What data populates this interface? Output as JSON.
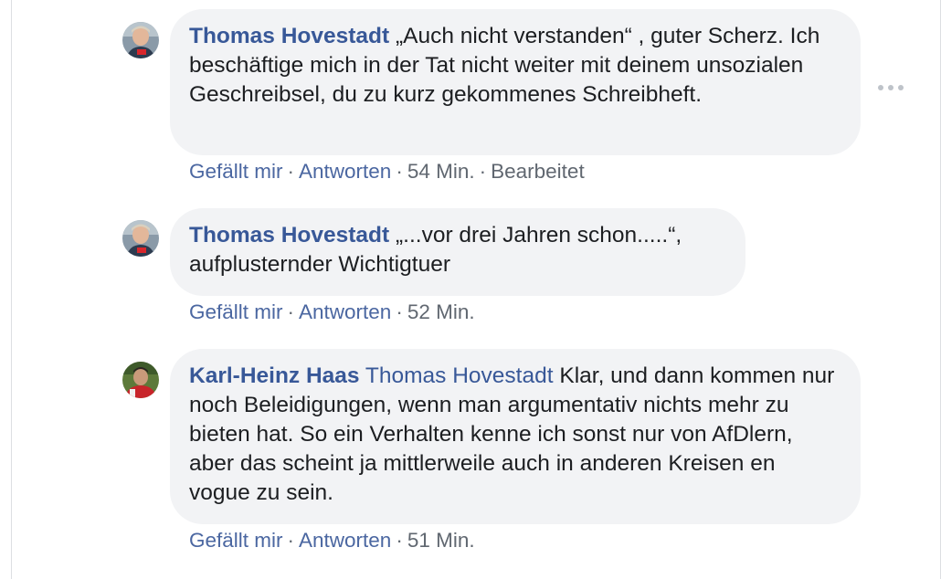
{
  "comments": [
    {
      "author": "Thomas Hovestadt",
      "mention": "",
      "text": " „Auch nicht verstanden“ , guter Scherz. Ich beschäftige mich in der Tat nicht weiter mit deinem unsozialen Geschreibsel, du zu kurz gekommenes Schreibheft.",
      "like_label": "Gefällt mir",
      "reply_label": "Antworten",
      "time": "54 Min.",
      "edited": "Bearbeitet",
      "avatar_icon": "profile-photo"
    },
    {
      "author": "Thomas Hovestadt",
      "mention": "",
      "text": " „...vor drei Jahren schon.....“, aufplusternder Wichtigtuer",
      "like_label": "Gefällt mir",
      "reply_label": "Antworten",
      "time": "52 Min.",
      "avatar_icon": "profile-photo"
    },
    {
      "author": "Karl-Heinz Haas",
      "mention": "Thomas Hovestadt",
      "text": " Klar, und dann kommen nur noch Beleidigungen, wenn man argumentativ nichts mehr zu bieten hat. So ein Verhalten kenne ich sonst nur von AfDlern, aber das scheint ja mittlerweile auch in anderen Kreisen en vogue zu sein.",
      "like_label": "Gefällt mir",
      "reply_label": "Antworten",
      "time": "51 Min.",
      "avatar_icon": "profile-photo"
    }
  ],
  "more_options_icon": "ellipsis-icon",
  "colors": {
    "link": "#385898",
    "bubble": "#f2f3f5",
    "text": "#1c1e21",
    "meta": "#606770"
  }
}
